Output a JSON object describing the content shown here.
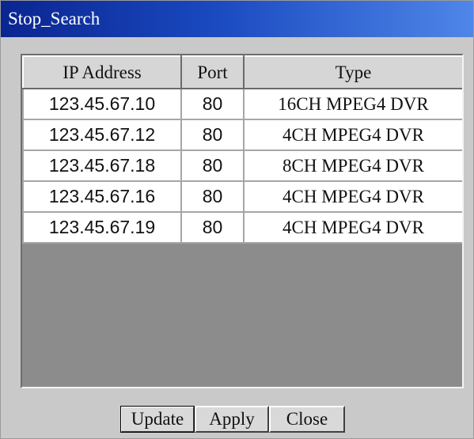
{
  "window": {
    "title": "Stop_Search"
  },
  "table": {
    "columns": [
      "IP Address",
      "Port",
      "Type"
    ],
    "rows": [
      {
        "ip": "123.45.67.10",
        "port": "80",
        "type": "16CH MPEG4 DVR"
      },
      {
        "ip": "123.45.67.12",
        "port": "80",
        "type": "4CH MPEG4 DVR"
      },
      {
        "ip": "123.45.67.18",
        "port": "80",
        "type": "8CH MPEG4 DVR"
      },
      {
        "ip": "123.45.67.16",
        "port": "80",
        "type": "4CH MPEG4 DVR"
      },
      {
        "ip": "123.45.67.19",
        "port": "80",
        "type": "4CH MPEG4 DVR"
      }
    ]
  },
  "buttons": {
    "update": "Update",
    "apply": "Apply",
    "close": "Close"
  }
}
